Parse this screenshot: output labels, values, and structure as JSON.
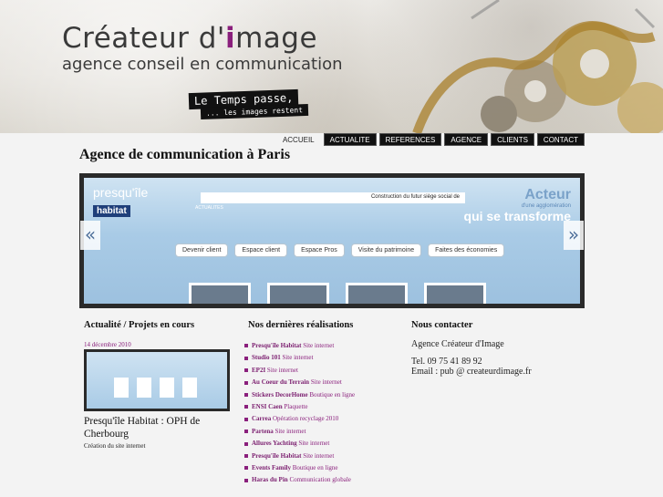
{
  "header": {
    "brand_title_part1": "Créateur d'",
    "brand_title_accent": "i",
    "brand_title_part2": "mage",
    "brand_subtitle": "agence conseil en communication",
    "slogan_line1": "Le Temps passe,",
    "slogan_line2": "... les images restent"
  },
  "nav": {
    "items": [
      {
        "label": "ACCUEIL"
      },
      {
        "label": "ACTUALITE"
      },
      {
        "label": "REFERENCES"
      },
      {
        "label": "AGENCE"
      },
      {
        "label": "CLIENTS"
      },
      {
        "label": "CONTACT"
      }
    ]
  },
  "page_title": "Agence de communication à Paris",
  "slider": {
    "logo_word": "presqu'île",
    "logo_sub": "habitat",
    "topbar_text": "Construction du futur siège social de",
    "actu_label": "ACTUALITES",
    "tagline_a": "Acteur",
    "tagline_b": "d'une agglomération",
    "tagline_c": "qui se transforme",
    "buttons": [
      "Devenir client",
      "Espace client",
      "Espace Pros",
      "Visite du patrimoine",
      "Faites des économies"
    ],
    "prev_glyph": "«",
    "next_glyph": "»"
  },
  "news": {
    "heading": "Actualité / Projets en cours",
    "date": "14 décembre 2010",
    "title": "Presqu'île Habitat : OPH de Cherbourg",
    "desc": "Création du site internet"
  },
  "realisations": {
    "heading": "Nos dernières réalisations",
    "items": [
      {
        "name": "Presqu'île Habitat",
        "type": "Site internet"
      },
      {
        "name": "Studio 101",
        "type": "Site internet"
      },
      {
        "name": "EP2I",
        "type": "Site internet"
      },
      {
        "name": "Au Coeur du Terrain",
        "type": "Site internet"
      },
      {
        "name": "Stickers DecorHome",
        "type": "Boutique en ligne"
      },
      {
        "name": "ENSI Caen",
        "type": "Plaquette"
      },
      {
        "name": "Carrea",
        "type": "Opération recyclage 2010"
      },
      {
        "name": "Partena",
        "type": "Site internet"
      },
      {
        "name": "Allures Yachting",
        "type": "Site internet"
      },
      {
        "name": "Presqu'île Habitat",
        "type": "Site internet"
      },
      {
        "name": "Events Family",
        "type": "Boutique en ligne"
      },
      {
        "name": "Haras du Pin",
        "type": "Communication globale"
      }
    ]
  },
  "contact": {
    "heading": "Nous contacter",
    "agency": "Agence Créateur d'Image",
    "tel": "Tel. 09 75 41 89 92",
    "email": "Email : pub @ createurdimage.fr"
  },
  "colors": {
    "accent": "#8a1f7c",
    "nav_bg": "#111111",
    "slider_frame": "#2a2a2a"
  }
}
